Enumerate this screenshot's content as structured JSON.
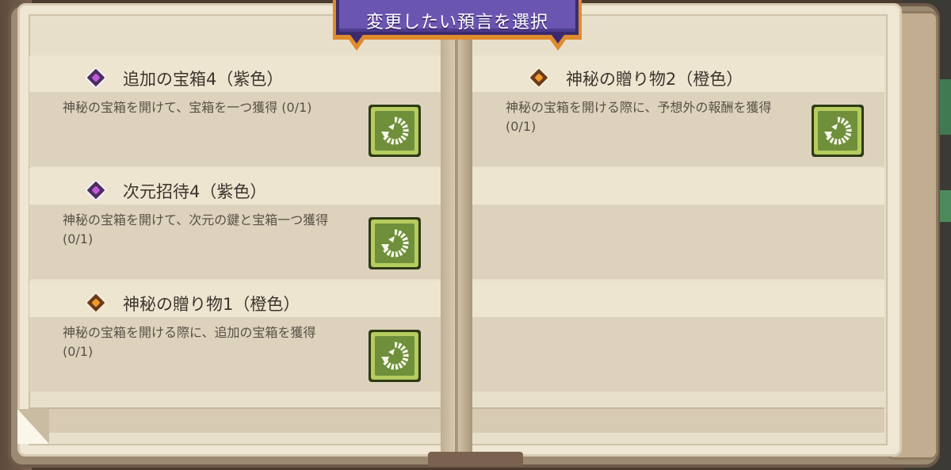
{
  "banner": {
    "title": "変更したい預言を選択"
  },
  "prophecies": [
    {
      "title": "追加の宝箱4（紫色）",
      "gem_color": "purple",
      "description": "神秘の宝箱を開けて、宝箱を一つ獲得 (0/1)",
      "icon": "reroll-icon"
    },
    {
      "title": "次元招待4（紫色）",
      "gem_color": "purple",
      "description": "神秘の宝箱を開けて、次元の鍵と宝箱一つ獲得 (0/1)",
      "icon": "reroll-icon"
    },
    {
      "title": "神秘の贈り物1（橙色）",
      "gem_color": "orange",
      "description": "神秘の宝箱を開ける際に、追加の宝箱を獲得 (0/1)",
      "icon": "reroll-icon"
    },
    {
      "title": "神秘の贈り物2（橙色）",
      "gem_color": "orange",
      "description": "神秘の宝箱を開ける際に、予想外の報酬を獲得 (0/1)",
      "icon": "reroll-icon"
    }
  ],
  "colors": {
    "banner": "#6a55b0",
    "button": "#6f8f3b",
    "gem_purple": "#c05ad8",
    "gem_orange": "#f19a2a"
  }
}
